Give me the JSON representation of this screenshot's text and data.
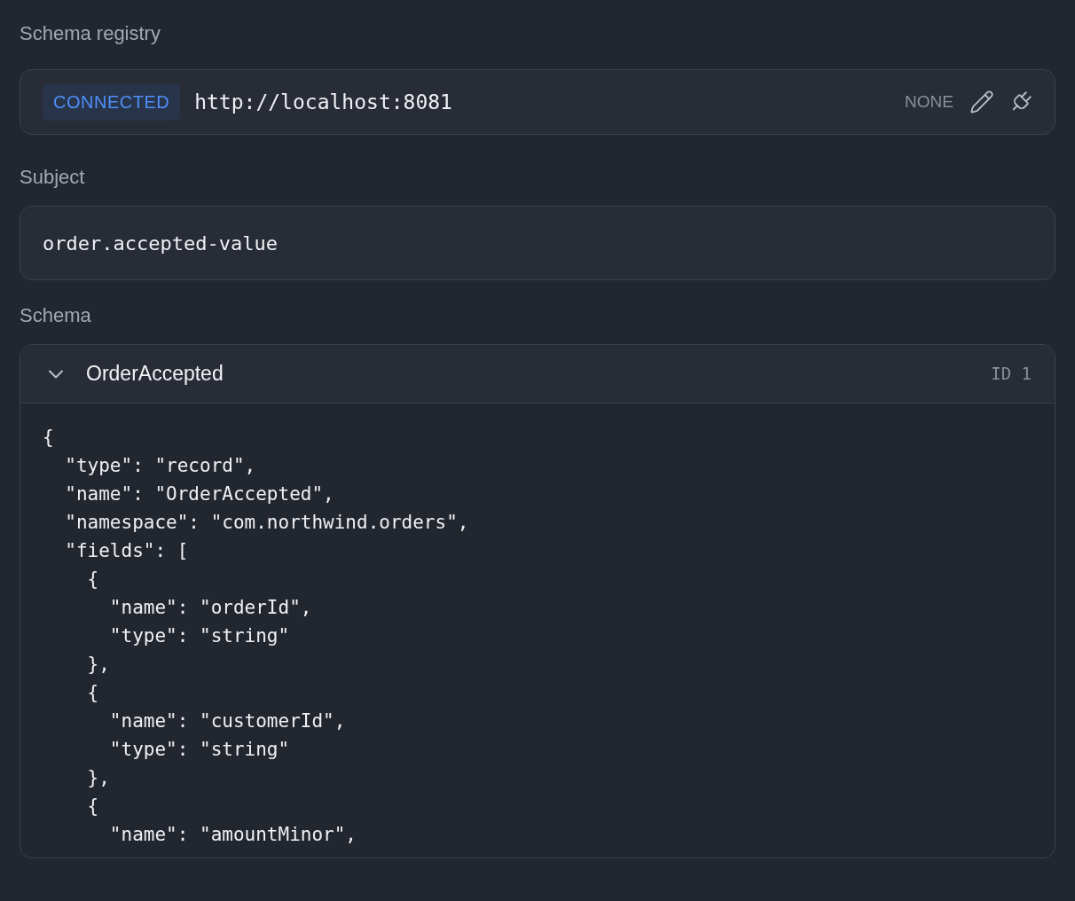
{
  "registry": {
    "label": "Schema registry",
    "status": "CONNECTED",
    "url": "http://localhost:8081",
    "auth": "NONE"
  },
  "subject": {
    "label": "Subject",
    "value": "order.accepted-value"
  },
  "schema": {
    "label": "Schema",
    "name": "OrderAccepted",
    "id": "ID 1",
    "expanded": true,
    "code_lines": [
      "{",
      "  \"type\": \"record\",",
      "  \"name\": \"OrderAccepted\",",
      "  \"namespace\": \"com.northwind.orders\",",
      "  \"fields\": [",
      "    {",
      "      \"name\": \"orderId\",",
      "      \"type\": \"string\"",
      "    },",
      "    {",
      "      \"name\": \"customerId\",",
      "      \"type\": \"string\"",
      "    },",
      "    {",
      "      \"name\": \"amountMinor\","
    ]
  }
}
